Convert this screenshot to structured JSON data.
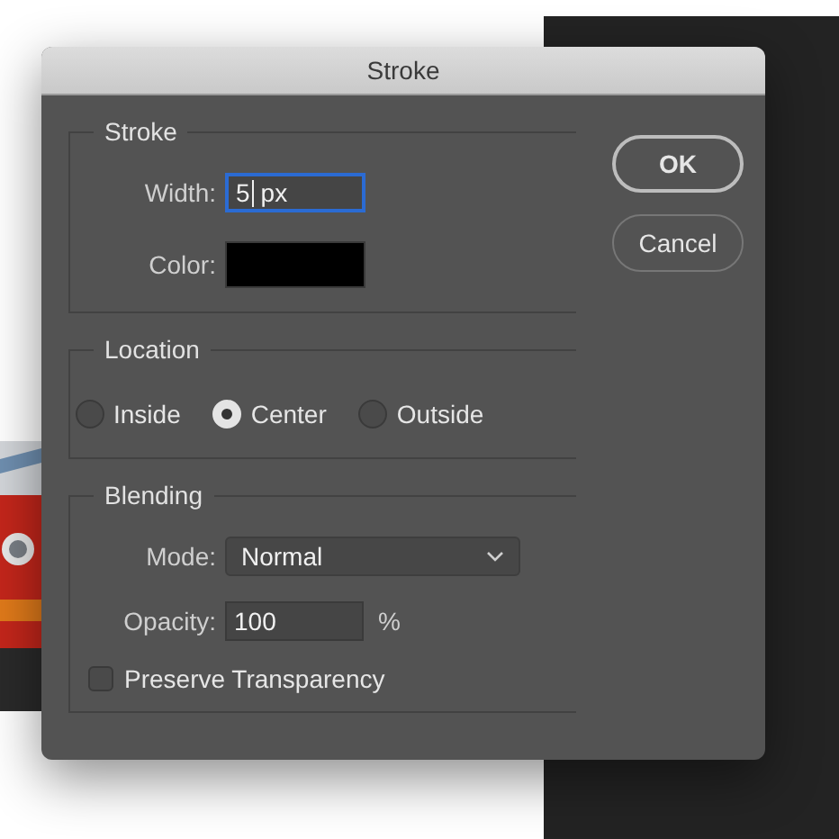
{
  "window": {
    "title": "Stroke"
  },
  "stroke": {
    "title": "Stroke",
    "width": {
      "label": "Width:",
      "value": "5",
      "unit": "px",
      "focused": true
    },
    "color": {
      "label": "Color:",
      "color": "#000000"
    }
  },
  "location": {
    "title": "Location",
    "options": [
      {
        "label": "Inside",
        "selected": false
      },
      {
        "label": "Center",
        "selected": true
      },
      {
        "label": "Outside",
        "selected": false
      }
    ]
  },
  "blending": {
    "title": "Blending",
    "mode": {
      "label": "Mode:",
      "value": "Normal"
    },
    "opacity": {
      "label": "Opacity:",
      "value": "100",
      "unit": "%"
    },
    "preserve_transparency": {
      "label": "Preserve Transparency",
      "checked": false
    }
  },
  "buttons": [
    {
      "label": "OK",
      "default": true
    },
    {
      "label": "Cancel",
      "default": false
    }
  ]
}
